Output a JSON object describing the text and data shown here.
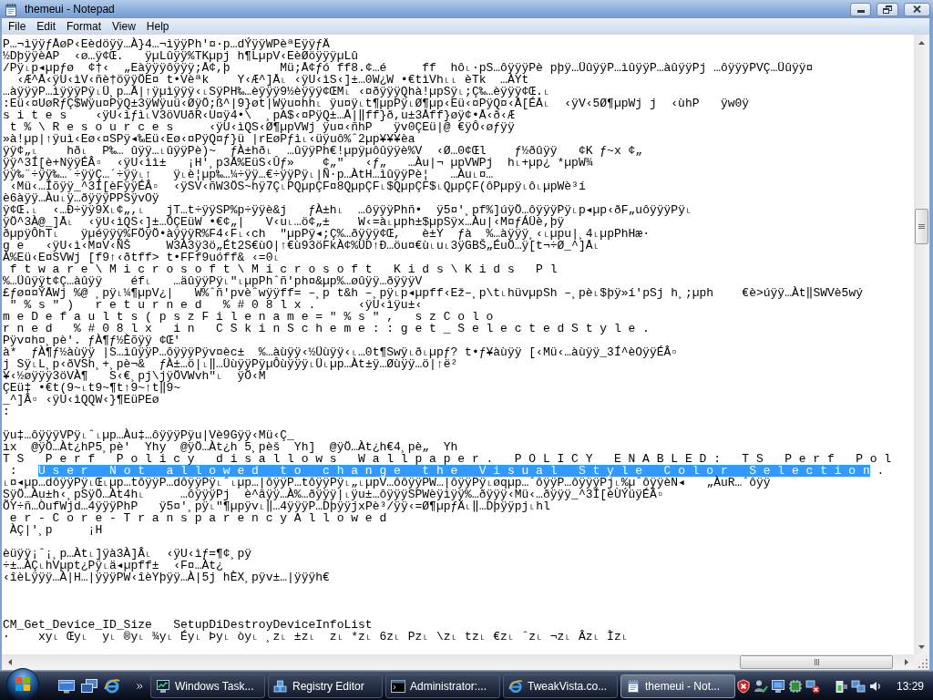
{
  "window": {
    "title": "themeui - Notepad"
  },
  "menu": [
    "File",
    "Edit",
    "Format",
    "View",
    "Help"
  ],
  "document": {
    "lines": [
      {
        "kind": "text",
        "text": "P…¬ìÿÿƒÅøP‹Eèdöÿÿ…À}4…¬ìÿÿPh'¤·p…dÝÿÿWPèªEÿÿƒÄ"
      },
      {
        "kind": "text",
        "text": "½DþÿÿèAP  ‹ø…ÿ¢Œ.   ÿµLûÿÿ%TKµpj h¶LµpV‹EèØöÿÿÿµLû"
      },
      {
        "kind": "text",
        "text": "/Pÿ˪p◂µpƒø  ¢†‹  „Eàÿÿÿôÿÿÿ;Å¢,þ       Mü;Å¢ƒó ff8.¢…é     ff  hô˪·pS…ôÿÿÿPè pþÿ…ÜûÿÿP…ìûÿÿP…àûÿÿPj …ôÿÿÿPVÇ…Üûÿÿ¤"
      },
      {
        "kind": "text",
        "text": "  ‹Æ^Å‹ÿU‹ìV‹ñè†öÿÿÖE¤ t•Vèªk    Y‹Æ^]Å˪ ‹ÿU‹ìS‹]±…0W¿W •€tìVh˪˪ èTk  …ÀYt"
      },
      {
        "kind": "text",
        "text": "…àÿÿÿP…ìÿÿÿPÿ˪Ü¸p…Å|↑ÿµìÿÿÿ‹˪SÿPH‰…èÿÿÿ9½èÿÿÿ¢ŒM˪ ‹¤ðÿÿÿQhà!µpSÿ˪;Ç‰…èÿÿÿ¢Œ.˪"
      },
      {
        "kind": "text",
        "text": ":Eü‹¤UøRƒÇ$Wÿu¤PÿQ±3ÿWÿuü‹ØÿÖ;ß^|9}øt|Wÿu¤hh˪ ÿu¤ÿ˪t¶µpPÿ˪Ø¶µp‹Eü‹¤PÿQ¤‹Å[ÉÅ˪  ‹ÿV‹5Ø¶µpWj j  ‹ùhP   ÿw0ÿ"
      },
      {
        "kind": "text",
        "text": "s i t e s    ‹ÿU‹ìƒì˪V3öVUðR‹U¤ÿ4•\\  ¸pA$‹¤PÿQ±…Å|‖ff}ð,u±3Åff}øÿ¢•Å‹ð‹Æ"
      },
      {
        "kind": "text",
        "text": " t % \\ R e s o u r c e s     ‹ÿU‹ìQS‹Ø¶µpVWj ÿu¤‹ñhP   ÿv0ÇEü|@ €ÿÔ‹øƒÿÿ"
      },
      {
        "kind": "text",
        "text": "»à!µp|↑ÿuì‹Eø‹¤SPÿ◂‰Eü‹Eø‹¤PÿQ¤ƒ}ü |rEøPƒì˪‹üÿuô%ˆ2µp¥¥¥èa"
      },
      {
        "kind": "text",
        "text": "ÿÿ¢„˪    hð˪  P‰… ûÿÿ…˪ûÿÿPè)~  ƒÀ±hð˪  …ûÿÿPh€!µpÿµôûÿÿè%V  ‹Ø…0¢Œl    ƒ½ðûÿÿ   ¢K ƒ~x ¢„"
      },
      {
        "kind": "text",
        "text": "ÿÿ^3Í[è+NÿÿÉÂ▫  ‹ÿU‹ìì±   ¡H'¸p3Å%EüS‹Ûƒ»    ¢„\"   ‹ƒ„   …Àu|¬ µpVWPj  h˪+µp¿ *µpW¾"
      },
      {
        "kind": "text",
        "text": "ÿÿ‰¨÷ÿÿ‰…´÷ÿÿÇ…´÷ÿÿ˪↑   ÿ˪è¦µp‰…¼÷ÿÿ…€÷ÿÿPÿ˪|Ñ·p…ÀtH…ìûÿÿPè¦   …Àu˪¤…"
      },
      {
        "kind": "text",
        "text": " ‹Mü‹…Íõÿÿ_^3Í[èFÿÿÉÂ▫  ‹ÿSV‹ñW3ÖS~hÿ7Ç˪PQµpÇF¤8QµpÇF˪$QµpÇF$˪QµpÇF(ôPµpÿ˪ô˪µpWè³í"
      },
      {
        "kind": "text",
        "text": "è6àÿÿ…Àu˪ÿ…ðÿÿÿPPSÿvOÿ"
      },
      {
        "kind": "text",
        "text": "ÿ¢Œ.˪  ‹…Ð÷ÿÿ9X˪¢„,˪   jT…t÷ÿÿSP%p÷ÿÿè&j   ƒÀ±h˪  …ôÿÿÿPhñ•  ÿ5¤'¸pf%]úÿÖ…ôÿÿÿPÿ˪p◂µp‹ðF„uôÿÿÿPÿ˪"
      },
      {
        "kind": "text",
        "text": "ÿÖ^3À@_]Å˪  ‹ÿU‹ìQS‹]±…ÖÇEüW •€¢„|   V‹u˪…ö¢„±    W‹=à˪µph±$µpSÿx…Àu|‹M¤ƒÁÜè,þÿ"
      },
      {
        "kind": "text",
        "text": "ðµpÿÔhT˪   ÿµéÿÿÿ%FÖÿÖ•àÿÿÿR%F4‹F˪‹ch  \"µpPÿ◂;Ç%…ðÿÿÿ¢Œ,   è±Y  ƒà  %…àÿÿÿ¸‹˪µpu|¸4˪µpPhHæ·"
      },
      {
        "kind": "text",
        "text": "g e   ‹ÿU‹ì‹M¤V‹ÑŠ     W3À3ÿ3ö„Ét2S€ùO|↑€ù93öFkÀ¢%ÜD↑Ð…öu¤€ù˪u˪3ÿGBŠ„ÉuÖ…ÿ[t¬÷Ø_^]Å˪"
      },
      {
        "kind": "text",
        "text": "À%Eü‹E¤SVWj [f9↑‹ðtff> t•FFf9uóff& ‹=0˪"
      },
      {
        "kind": "text",
        "text": " f t w a r e \\ M i c r o s o f t \\ M i c r o s o f t   K i d s \\ K i d s   P l"
      },
      {
        "kind": "text",
        "text": "%…Üûÿÿt¢Ç…àûÿÿ    éf˪   …äûÿÿPÿ˪\"˪µpPhˆñ'ph¤&µp%…øûÿÿ…ðÿÿÿV"
      },
      {
        "kind": "text",
        "text": "£ƒø¤¤ÝÅWj %@ ¸pÿ˪¼¶µpV¿|   W%ˆñ'pvèˆwÿÿff= –¸p t&h –¸pÿ˪p◂µpff‹Ež–¸p\\t˪hüvµpSh –¸pè˪$þÿ»í'pSj h¸;µph    €è>úÿÿ…Àt‖SWVè5wý"
      },
      {
        "kind": "text",
        "text": " \" % s \" )   r e t u r n e d   % # 0 8 l x .      ‹ÿU‹ìÿu±‹"
      },
      {
        "kind": "text",
        "text": "m e D e f a u l t s ( p s z F i l e n a m e = \" % s \" ,   s z C o l o"
      },
      {
        "kind": "text",
        "text": "r n e d   % # 0 8 l x   i n   C S k i n S c h e m e : : g e t _ S e l e c t e d S t y l e ."
      },
      {
        "kind": "text",
        "text": "Pÿv¤h¤¸pè'. ƒÀ¶ƒ½Èõÿÿ ¢Œ'"
      },
      {
        "kind": "text",
        "text": "à*  ƒÀ¶ƒ½àùÿÿ |S…ìûÿÿP…ôÿÿÿPÿv¤èc±  %…àùÿÿ‹½Üùÿÿ‹˪…0t¶Swÿ˪ð˪µpƒ? t•ƒ¥àùÿÿ [‹Mü‹…àùÿÿ_3Í^èOÿÿÉÂ▫"
      },
      {
        "kind": "text",
        "text": "j Sÿ˪L¸p‹ðVSh¸+¸pè¬&  ƒÀ±…ö|˪‖…ÜùÿÿPÿµÔùÿÿÿ˪Ü˪µp…Àt±ÿ…Øùÿÿ…ö|↑ë²"
      },
      {
        "kind": "text",
        "text": "¥‹½øÿÿÿ3öVÀ¶   S‹€¸pj\\jÿÖVWvh\"˪  ÿÖ‹M"
      },
      {
        "kind": "text",
        "text": "ÇEü‡ •€t(9~˪t9~¶t↑9~↑t‖9~"
      },
      {
        "kind": "text",
        "text": "_^]Â▫ ‹ÿU‹ìQQW‹}¶EüPEø"
      },
      {
        "kind": "text",
        "text": ":"
      },
      {
        "kind": "blank"
      },
      {
        "kind": "text",
        "text": "ÿu‡…ôÿÿÿVPÿ˪ˆ˪µp…Àu‡…ôÿÿÿPÿu|Vè9Gÿÿ‹Mü‹Ç_"
      },
      {
        "kind": "text",
        "text": "ıx  @ÿÖ…Àt¿hP5¸pè'  Yhy  @ÿÖ…Àt¿h 5¸pèš  Yh]  @ÿÖ…Àt¿h€4¸pè„  Yh"
      },
      {
        "kind": "text",
        "text": "T S   P e r f   P o l i c y   d i s a l l o w s   W a l l p a p e r .   P O L I C Y   E N A B L E D :   T S   P e r f   P o l"
      },
      {
        "kind": "selection",
        "before": " :   ",
        "selected": "U s e r   N o t   a l l o w e d   t o   c h a n g e   t h e   V i s u a l   S t y l e   C o l o r   S e l e c t i o n",
        "after": " ."
      },
      {
        "kind": "text",
        "text": "˪¤◂µp…dôÿÿPÿ˪Œ˪µp…tôÿÿP…dôÿÿPÿ˪ˆ˪µp…|ôÿÿP…tôÿÿPÿ˪„˪µpV…ôôÿÿPW…|ôÿÿPÿ˪øqµp…ˆôÿÿP…ôÿÿÿPj˪%µˆôÿÿèN◂   „ÀuR…ˆôÿÿ"
      },
      {
        "kind": "text",
        "text": "SÿÖ…Àu±h‹¸pSÿÖ…Àt4h˪     …ôÿÿÿPj  è^âÿÿ…À%…ðÿÿÿ|˪ÿu±…ôÿÿÿSPWèÿìÿÿ%…ðÿÿÿ‹Mü‹…ðÿÿÿ_^3Í[èÙÝüÿÉÂ▫"
      },
      {
        "kind": "text",
        "text": "ÕY÷ñ…ÒufWjd…4ÿÿÿPhP   ÿ5¤'¸pÿ˪\"¶µpÿv˪‖…4ÿÿÿP…DþÿÿjxPè³/ÿÿ‹=Ø¶µpƒÄ˪‖…Dþÿÿpj˪hl"
      },
      {
        "kind": "text",
        "text": " e r - C o r e - T r a n s p a r e n c y A l l o w e d"
      },
      {
        "kind": "text",
        "text": " ÀÇ|'¸p     ¡H"
      },
      {
        "kind": "blank"
      },
      {
        "kind": "text",
        "text": "èüÿÿ¡ˆ¡¸p…Àt˪]ÿà3À]Â˪  ‹ÿU‹ìƒ=¶¢¸pÿ"
      },
      {
        "kind": "text",
        "text": "÷±…ÀÇ˪hVµpt¿Pÿ˪ä◂µpff±  ‹F¤…Àt¿"
      },
      {
        "kind": "text",
        "text": "‹îèLÿÿÿ…À|H…|ÿÿÿPW‹îèYþÿÿ…À|5j hÈX¸pÿv±…|ÿÿÿh€"
      },
      {
        "kind": "blank"
      },
      {
        "kind": "blank"
      },
      {
        "kind": "blank"
      },
      {
        "kind": "text",
        "text": "CM_Get_Device_ID_Size   SetupDiDestroyDeviceInfoList"
      },
      {
        "kind": "text",
        "text": "·    xy˪ Œy˪  y˪ ®y˪ ¾y˪ Éy˪ Þy˪ òy˪ ¸z˪ ±z˪  z˪ *z˪ 6z˪ Pz˪ \\z˪ tz˪ €z˪ ˆz˪ ¬z˪ Âz˪ Ìz˪"
      }
    ]
  },
  "taskbar": {
    "tasks": [
      {
        "kind": "task_manager",
        "label": "Windows Task...",
        "selected": false
      },
      {
        "kind": "registry",
        "label": "Registry Editor",
        "selected": false
      },
      {
        "kind": "console",
        "label": "Administrator:...",
        "selected": false
      },
      {
        "kind": "browser",
        "label": "TweakVista.co...",
        "selected": false
      },
      {
        "kind": "notepad",
        "label": "themeui - Not...",
        "selected": true
      }
    ],
    "clock": "13:29"
  }
}
